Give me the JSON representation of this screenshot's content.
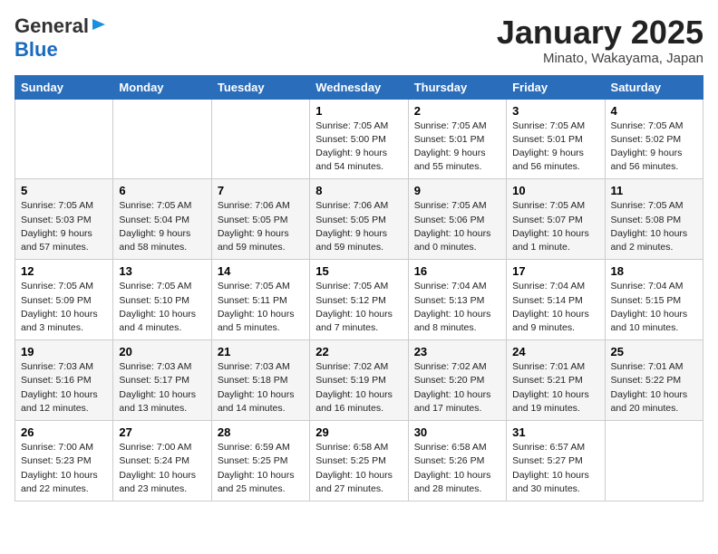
{
  "header": {
    "logo_general": "General",
    "logo_blue": "Blue",
    "month": "January 2025",
    "location": "Minato, Wakayama, Japan"
  },
  "days_of_week": [
    "Sunday",
    "Monday",
    "Tuesday",
    "Wednesday",
    "Thursday",
    "Friday",
    "Saturday"
  ],
  "weeks": [
    [
      {
        "day": "",
        "info": ""
      },
      {
        "day": "",
        "info": ""
      },
      {
        "day": "",
        "info": ""
      },
      {
        "day": "1",
        "info": "Sunrise: 7:05 AM\nSunset: 5:00 PM\nDaylight: 9 hours\nand 54 minutes."
      },
      {
        "day": "2",
        "info": "Sunrise: 7:05 AM\nSunset: 5:01 PM\nDaylight: 9 hours\nand 55 minutes."
      },
      {
        "day": "3",
        "info": "Sunrise: 7:05 AM\nSunset: 5:01 PM\nDaylight: 9 hours\nand 56 minutes."
      },
      {
        "day": "4",
        "info": "Sunrise: 7:05 AM\nSunset: 5:02 PM\nDaylight: 9 hours\nand 56 minutes."
      }
    ],
    [
      {
        "day": "5",
        "info": "Sunrise: 7:05 AM\nSunset: 5:03 PM\nDaylight: 9 hours\nand 57 minutes."
      },
      {
        "day": "6",
        "info": "Sunrise: 7:05 AM\nSunset: 5:04 PM\nDaylight: 9 hours\nand 58 minutes."
      },
      {
        "day": "7",
        "info": "Sunrise: 7:06 AM\nSunset: 5:05 PM\nDaylight: 9 hours\nand 59 minutes."
      },
      {
        "day": "8",
        "info": "Sunrise: 7:06 AM\nSunset: 5:05 PM\nDaylight: 9 hours\nand 59 minutes."
      },
      {
        "day": "9",
        "info": "Sunrise: 7:05 AM\nSunset: 5:06 PM\nDaylight: 10 hours\nand 0 minutes."
      },
      {
        "day": "10",
        "info": "Sunrise: 7:05 AM\nSunset: 5:07 PM\nDaylight: 10 hours\nand 1 minute."
      },
      {
        "day": "11",
        "info": "Sunrise: 7:05 AM\nSunset: 5:08 PM\nDaylight: 10 hours\nand 2 minutes."
      }
    ],
    [
      {
        "day": "12",
        "info": "Sunrise: 7:05 AM\nSunset: 5:09 PM\nDaylight: 10 hours\nand 3 minutes."
      },
      {
        "day": "13",
        "info": "Sunrise: 7:05 AM\nSunset: 5:10 PM\nDaylight: 10 hours\nand 4 minutes."
      },
      {
        "day": "14",
        "info": "Sunrise: 7:05 AM\nSunset: 5:11 PM\nDaylight: 10 hours\nand 5 minutes."
      },
      {
        "day": "15",
        "info": "Sunrise: 7:05 AM\nSunset: 5:12 PM\nDaylight: 10 hours\nand 7 minutes."
      },
      {
        "day": "16",
        "info": "Sunrise: 7:04 AM\nSunset: 5:13 PM\nDaylight: 10 hours\nand 8 minutes."
      },
      {
        "day": "17",
        "info": "Sunrise: 7:04 AM\nSunset: 5:14 PM\nDaylight: 10 hours\nand 9 minutes."
      },
      {
        "day": "18",
        "info": "Sunrise: 7:04 AM\nSunset: 5:15 PM\nDaylight: 10 hours\nand 10 minutes."
      }
    ],
    [
      {
        "day": "19",
        "info": "Sunrise: 7:03 AM\nSunset: 5:16 PM\nDaylight: 10 hours\nand 12 minutes."
      },
      {
        "day": "20",
        "info": "Sunrise: 7:03 AM\nSunset: 5:17 PM\nDaylight: 10 hours\nand 13 minutes."
      },
      {
        "day": "21",
        "info": "Sunrise: 7:03 AM\nSunset: 5:18 PM\nDaylight: 10 hours\nand 14 minutes."
      },
      {
        "day": "22",
        "info": "Sunrise: 7:02 AM\nSunset: 5:19 PM\nDaylight: 10 hours\nand 16 minutes."
      },
      {
        "day": "23",
        "info": "Sunrise: 7:02 AM\nSunset: 5:20 PM\nDaylight: 10 hours\nand 17 minutes."
      },
      {
        "day": "24",
        "info": "Sunrise: 7:01 AM\nSunset: 5:21 PM\nDaylight: 10 hours\nand 19 minutes."
      },
      {
        "day": "25",
        "info": "Sunrise: 7:01 AM\nSunset: 5:22 PM\nDaylight: 10 hours\nand 20 minutes."
      }
    ],
    [
      {
        "day": "26",
        "info": "Sunrise: 7:00 AM\nSunset: 5:23 PM\nDaylight: 10 hours\nand 22 minutes."
      },
      {
        "day": "27",
        "info": "Sunrise: 7:00 AM\nSunset: 5:24 PM\nDaylight: 10 hours\nand 23 minutes."
      },
      {
        "day": "28",
        "info": "Sunrise: 6:59 AM\nSunset: 5:25 PM\nDaylight: 10 hours\nand 25 minutes."
      },
      {
        "day": "29",
        "info": "Sunrise: 6:58 AM\nSunset: 5:25 PM\nDaylight: 10 hours\nand 27 minutes."
      },
      {
        "day": "30",
        "info": "Sunrise: 6:58 AM\nSunset: 5:26 PM\nDaylight: 10 hours\nand 28 minutes."
      },
      {
        "day": "31",
        "info": "Sunrise: 6:57 AM\nSunset: 5:27 PM\nDaylight: 10 hours\nand 30 minutes."
      },
      {
        "day": "",
        "info": ""
      }
    ]
  ]
}
